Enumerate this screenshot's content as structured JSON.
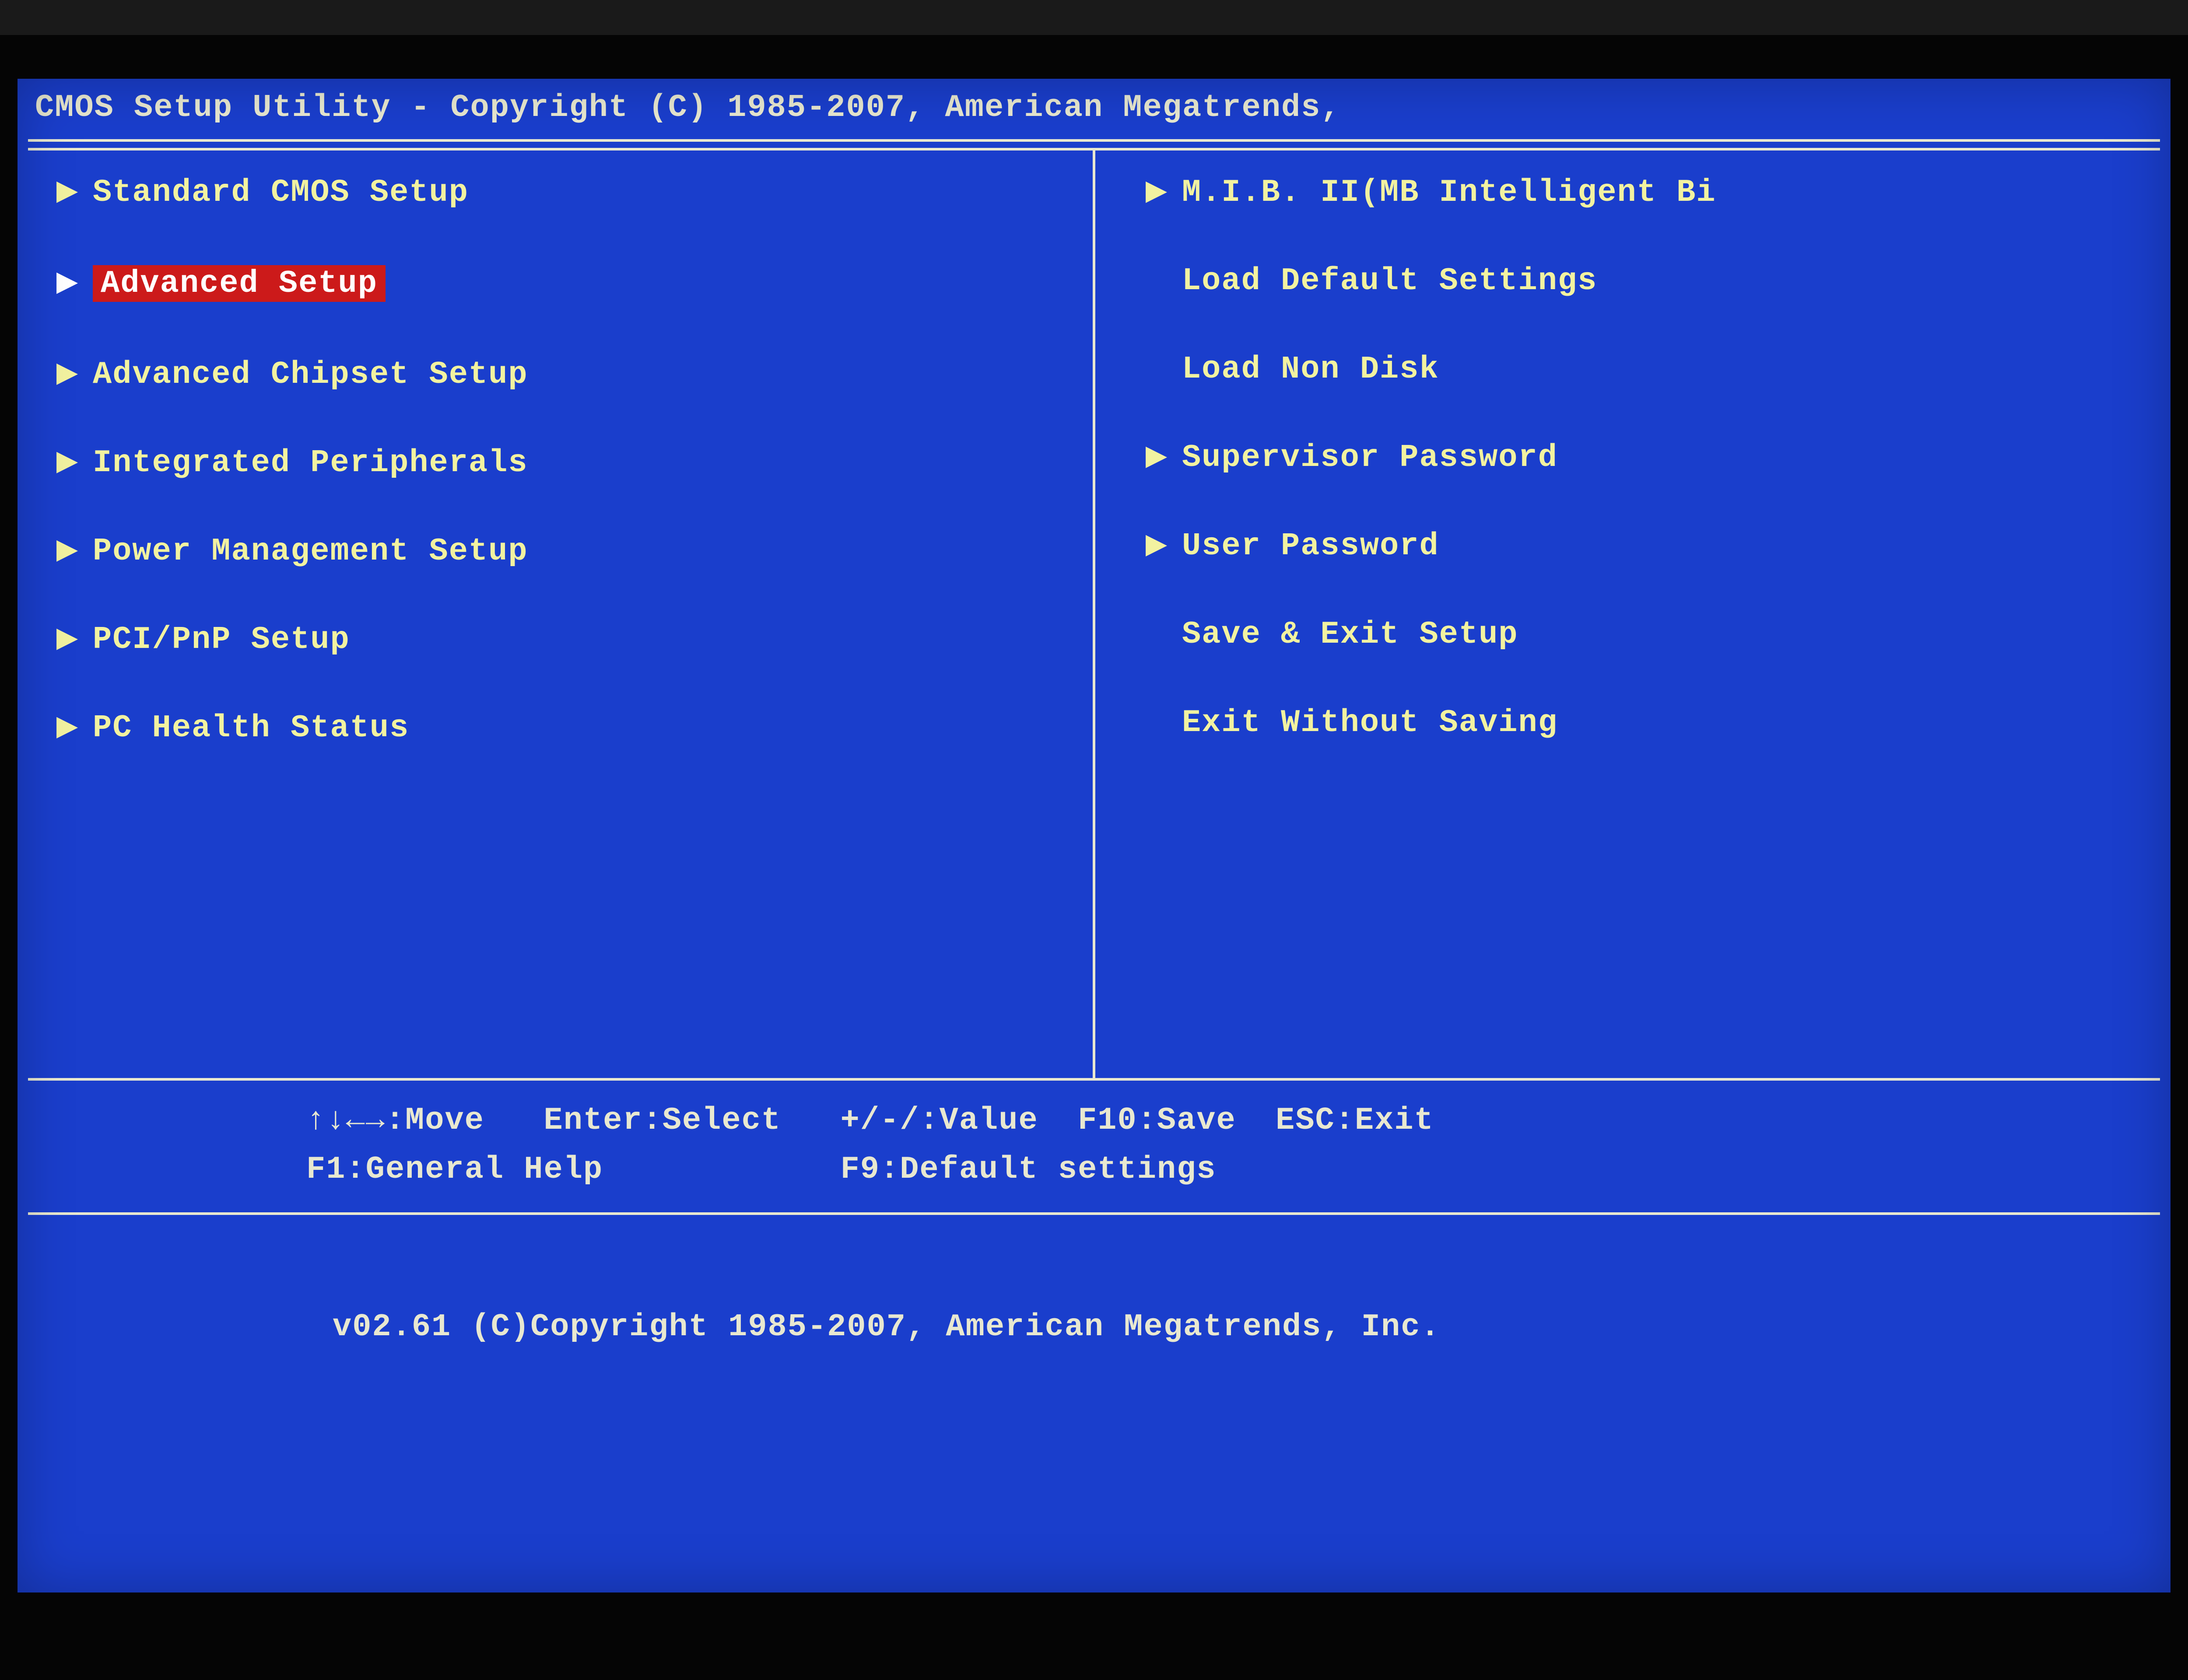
{
  "title": "CMOS Setup Utility - Copyright (C) 1985-2007, American Megatrends,",
  "menu": {
    "left": [
      {
        "label": "Standard CMOS Setup",
        "tri": true,
        "selected": false
      },
      {
        "label": "Advanced Setup",
        "tri": true,
        "selected": true
      },
      {
        "label": "Advanced Chipset Setup",
        "tri": true,
        "selected": false
      },
      {
        "label": "Integrated Peripherals",
        "tri": true,
        "selected": false
      },
      {
        "label": "Power Management Setup",
        "tri": true,
        "selected": false
      },
      {
        "label": "PCI/PnP Setup",
        "tri": true,
        "selected": false
      },
      {
        "label": "PC Health Status",
        "tri": true,
        "selected": false
      }
    ],
    "right": [
      {
        "label": "M.I.B. II(MB Intelligent Bi",
        "tri": true,
        "selected": false
      },
      {
        "label": "Load Default Settings",
        "tri": false,
        "selected": false
      },
      {
        "label": "Load Non Disk",
        "tri": false,
        "selected": false
      },
      {
        "label": "Supervisor Password",
        "tri": true,
        "selected": false
      },
      {
        "label": "User Password",
        "tri": true,
        "selected": false
      },
      {
        "label": "Save & Exit Setup",
        "tri": false,
        "selected": false
      },
      {
        "label": "Exit Without Saving",
        "tri": false,
        "selected": false
      }
    ]
  },
  "help": {
    "line1": "↑↓←→:Move   Enter:Select   +/-/:Value  F10:Save  ESC:Exit",
    "line2": "F1:General Help            F9:Default settings"
  },
  "footer": "v02.61 (C)Copyright 1985-2007, American Megatrends, Inc."
}
